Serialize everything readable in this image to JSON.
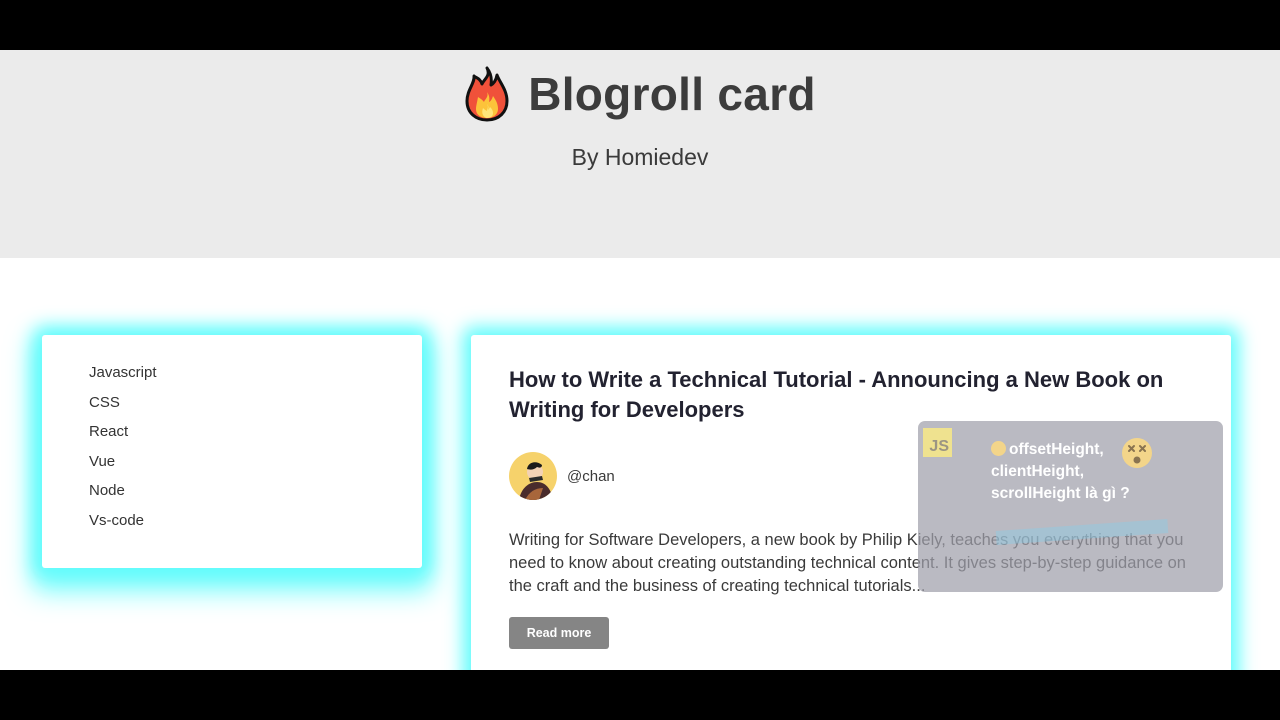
{
  "header": {
    "title": "Blogroll card",
    "byline": "By Homiedev",
    "logo_icon": "fire-icon"
  },
  "sidebar": {
    "items": [
      {
        "label": "Javascript"
      },
      {
        "label": "CSS"
      },
      {
        "label": "React"
      },
      {
        "label": "Vue"
      },
      {
        "label": "Node"
      },
      {
        "label": "Vs-code"
      }
    ]
  },
  "post": {
    "title": "How to Write a Technical Tutorial - Announcing a New Book on Writing for Developers",
    "author": "@chan",
    "avatar_icon": "avatar",
    "excerpt": "Writing for Software Developers, a new book by Philip Kiely, teaches you everything that you need to know about creating outstanding technical content. It gives step-by-step guidance on the craft and the business of creating technical tutorials...",
    "read_more_label": "Read more"
  },
  "popup": {
    "badge": "JS",
    "lines": [
      "offsetHeight,",
      "clientHeight,",
      "scrollHeight là gì ?"
    ]
  },
  "colors": {
    "header_bg": "#ebebeb",
    "glow": "#5ffcfc",
    "button_bg": "#858585",
    "title_text": "#3c3c3c"
  }
}
